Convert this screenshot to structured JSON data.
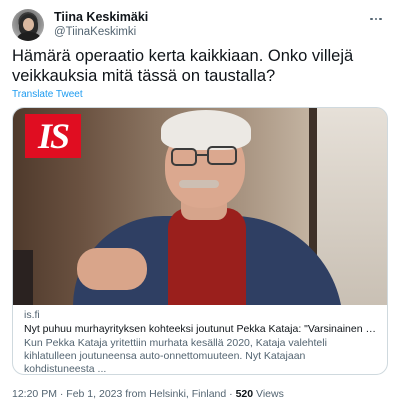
{
  "author": {
    "display_name": "Tiina Keskimäki",
    "handle": "@TiinaKeskimki"
  },
  "tweet": {
    "text": "Hämärä operaatio kerta kaikkiaan. Onko villejä veikkauksia mitä tässä on taustalla?",
    "translate_label": "Translate Tweet"
  },
  "card": {
    "logo_text": "IS",
    "domain": "is.fi",
    "title": "Nyt puhuu murhayrityksen kohteeksi joutunut Pekka Kataja: \"Varsinainen te...",
    "description": "Kun Pekka Kataja yritettiin murhata kesällä 2020, Kataja valehteli kihlatulleen joutuneensa auto-onnettomuuteen. Nyt Katajaan kohdistuneesta ..."
  },
  "meta": {
    "time": "12:20 PM",
    "separator": "·",
    "date": "Feb 1, 2023 from Helsinki, Finland",
    "views_count": "520",
    "views_label": "Views"
  },
  "colors": {
    "link": "#1d9bf0",
    "secondary_text": "#536471",
    "logo_red": "#e00d21"
  }
}
